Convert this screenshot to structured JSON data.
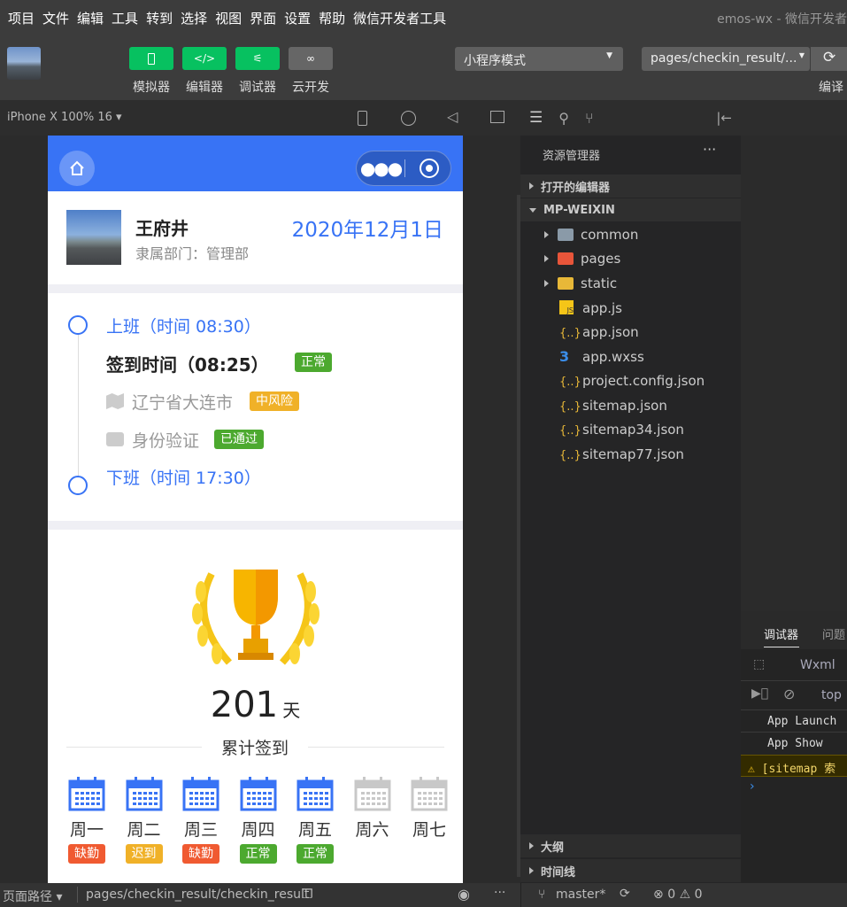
{
  "menu": [
    "项目",
    "文件",
    "编辑",
    "工具",
    "转到",
    "选择",
    "视图",
    "界面",
    "设置",
    "帮助",
    "微信开发者工具"
  ],
  "window_title": "emos-wx - 微信开发者",
  "toolbar": {
    "simulator": "模拟器",
    "editor": "编辑器",
    "debugger": "调试器",
    "cloud": "云开发",
    "mode": "小程序模式",
    "page": "pages/checkin_result/...",
    "compile": "编译"
  },
  "sim_header": {
    "device": "iPhone X 100% 16"
  },
  "page": {
    "name": "王府井",
    "dept": "隶属部门：管理部",
    "date": "2020年12月1日",
    "checkin_label": "上班（时间 08:30）",
    "checkin_time": "签到时间（08:25）",
    "checkin_status": "正常",
    "location": "辽宁省大连市",
    "risk": "中风险",
    "identity": "身份验证",
    "identity_status": "已通过",
    "checkout_label": "下班（时间 17:30）",
    "days_count": "201",
    "days_unit": "天",
    "total_label": "累计签到",
    "week": [
      {
        "day": "周一",
        "status": "缺勤",
        "color": "#f05a31",
        "active": true
      },
      {
        "day": "周二",
        "status": "迟到",
        "color": "#f0b128",
        "active": true
      },
      {
        "day": "周三",
        "status": "缺勤",
        "color": "#f05a31",
        "active": true
      },
      {
        "day": "周四",
        "status": "正常",
        "color": "#4ca92f",
        "active": true
      },
      {
        "day": "周五",
        "status": "正常",
        "color": "#4ca92f",
        "active": true
      },
      {
        "day": "周六",
        "status": "",
        "active": false
      },
      {
        "day": "周七",
        "status": "",
        "active": false
      }
    ]
  },
  "explorer": {
    "title": "资源管理器",
    "open_editors": "打开的编辑器",
    "project": "MP-WEIXIN",
    "folders": [
      "common",
      "pages",
      "static"
    ],
    "files": [
      "app.js",
      "app.json",
      "app.wxss",
      "project.config.json",
      "sitemap.json",
      "sitemap34.json",
      "sitemap77.json"
    ],
    "outline": "大纲",
    "timeline": "时间线"
  },
  "debugger": {
    "tab1": "调试器",
    "tab2": "问题",
    "wxml": "Wxml",
    "context": "top",
    "logs": [
      "App Launch",
      "App Show"
    ],
    "warning": "[sitemap 索"
  },
  "status": {
    "path_label": "页面路径",
    "path": "pages/checkin_result/checkin_result",
    "branch": "master*",
    "errors": "0",
    "warnings": "0"
  },
  "colors": {
    "accent": "#3873f5",
    "green": "#07c160"
  }
}
